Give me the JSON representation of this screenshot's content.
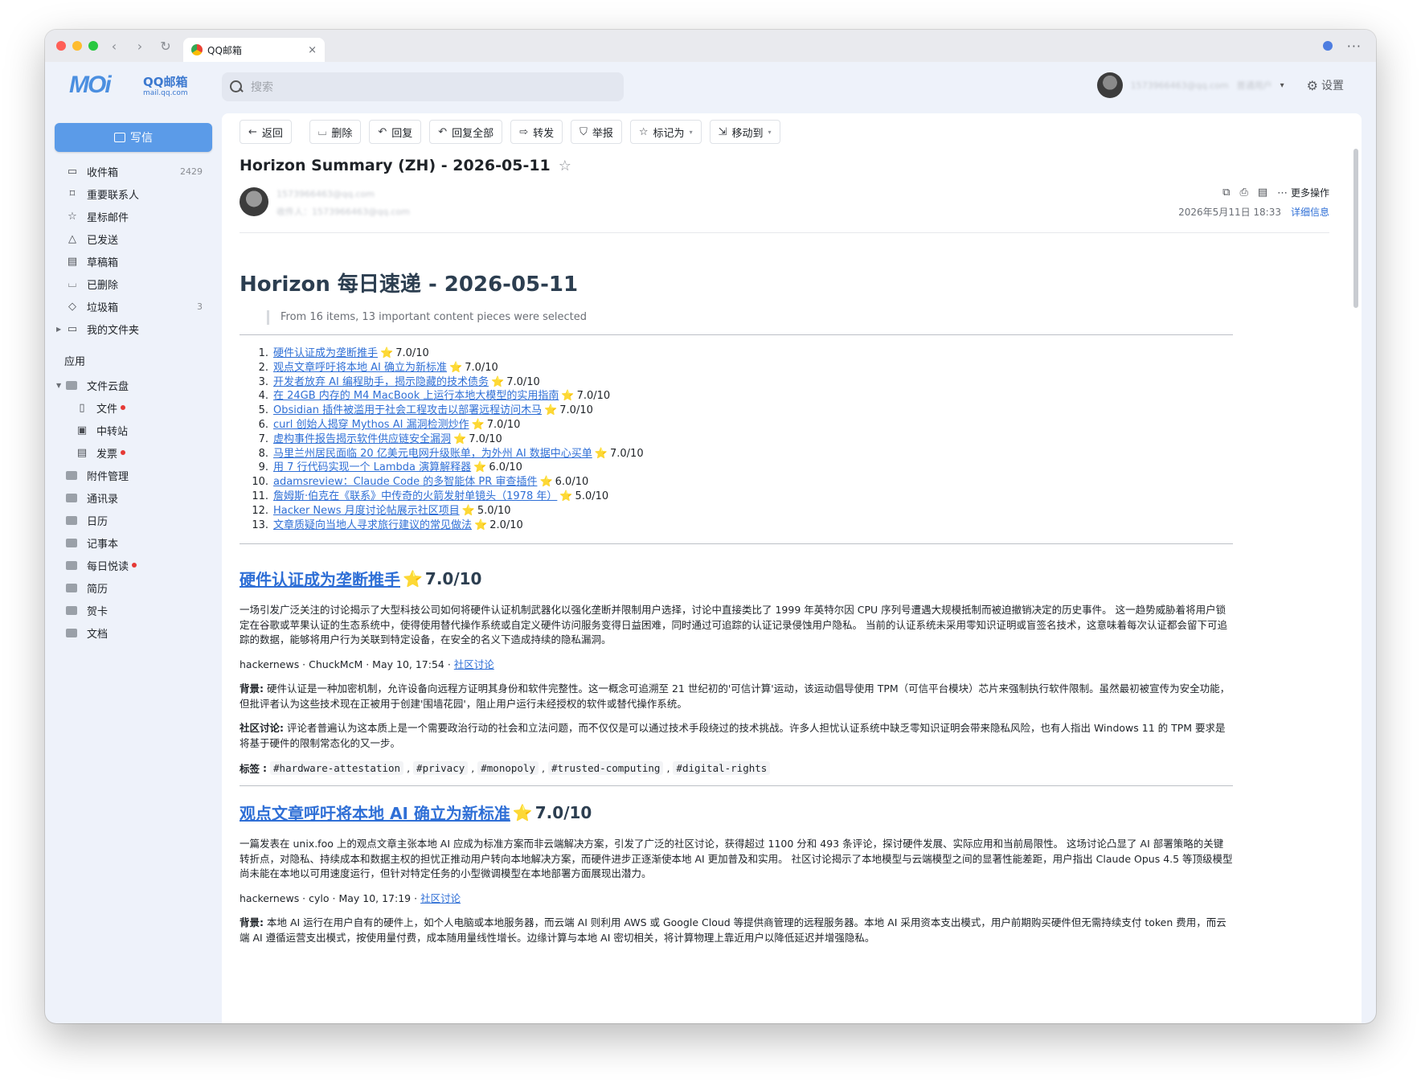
{
  "browser": {
    "tab_title": "QQ邮箱",
    "tab_close": "×",
    "back": "‹",
    "forward": "›",
    "reload": "↻",
    "menu": "···"
  },
  "header": {
    "logo_mark": "MOi",
    "logo_cn": "QQ邮箱",
    "logo_domain": "mail.qq.com",
    "search_placeholder": "搜索",
    "user_email_blurred": "1573966463@qq.com",
    "user_suffix": "普通用户",
    "settings_label": "设置"
  },
  "sidebar": {
    "compose_label": "写信",
    "folders": [
      {
        "icon": "inbox-icon",
        "glyph": "▭",
        "label": "收件箱",
        "count": "2429"
      },
      {
        "icon": "bookmark-icon",
        "glyph": "⌑",
        "label": "重要联系人",
        "count": ""
      },
      {
        "icon": "star-icon",
        "glyph": "☆",
        "label": "星标邮件",
        "count": ""
      },
      {
        "icon": "sent-icon",
        "glyph": "△",
        "label": "已发送",
        "count": ""
      },
      {
        "icon": "draft-icon",
        "glyph": "▤",
        "label": "草稿箱",
        "count": ""
      },
      {
        "icon": "trash-icon",
        "glyph": "🗑",
        "label": "已删除",
        "count": ""
      },
      {
        "icon": "spam-icon",
        "glyph": "⛉",
        "label": "垃圾箱",
        "count": "3"
      },
      {
        "icon": "folder-icon",
        "glyph": "▭",
        "label": "我的文件夹",
        "count": ""
      }
    ],
    "apps_label": "应用",
    "cloud_label": "文件云盘",
    "cloud_items": [
      {
        "label": "文件",
        "dot": true
      },
      {
        "label": "中转站",
        "dot": false
      },
      {
        "label": "发票",
        "dot": true
      }
    ],
    "apps": [
      {
        "label": "附件管理",
        "dot": false
      },
      {
        "label": "通讯录",
        "dot": false
      },
      {
        "label": "日历",
        "dot": false
      },
      {
        "label": "记事本",
        "dot": false
      },
      {
        "label": "每日悦读",
        "dot": true
      },
      {
        "label": "简历",
        "dot": false
      },
      {
        "label": "贺卡",
        "dot": false
      },
      {
        "label": "文档",
        "dot": false
      }
    ]
  },
  "toolbar": {
    "back": "返回",
    "delete": "删除",
    "reply": "回复",
    "reply_all": "回复全部",
    "forward": "转发",
    "report": "举报",
    "mark_as": "标记为",
    "move_to": "移动到"
  },
  "mail": {
    "subject": "Horizon Summary (ZH) - 2026-05-11",
    "sender_blurred": "1573966463@qq.com",
    "recipient_blurred": "收件人：1573966463@qq.com",
    "more_actions": "更多操作",
    "date": "2026年5月11日 18:33",
    "detail_link": "详细信息"
  },
  "content": {
    "h1": "Horizon 每日速递 - 2026-05-11",
    "quote": "From 16 items, 13 important content pieces were selected",
    "toc": [
      {
        "num": "1.",
        "title": "硬件认证成为垄断推手",
        "score": "7.0/10"
      },
      {
        "num": "2.",
        "title": "观点文章呼吁将本地 AI 确立为新标准",
        "score": "7.0/10"
      },
      {
        "num": "3.",
        "title": "开发者放弃 AI 编程助手，揭示隐藏的技术债务",
        "score": "7.0/10"
      },
      {
        "num": "4.",
        "title": "在 24GB 内存的 M4 MacBook 上运行本地大模型的实用指南",
        "score": "7.0/10"
      },
      {
        "num": "5.",
        "title": "Obsidian 插件被滥用于社会工程攻击以部署远程访问木马",
        "score": "7.0/10"
      },
      {
        "num": "6.",
        "title": "curl 创始人揭穿 Mythos AI 漏洞检测炒作",
        "score": "7.0/10"
      },
      {
        "num": "7.",
        "title": "虚构事件报告揭示软件供应链安全漏洞",
        "score": "7.0/10"
      },
      {
        "num": "8.",
        "title": "马里兰州居民面临 20 亿美元电网升级账单，为外州 AI 数据中心买单",
        "score": "7.0/10"
      },
      {
        "num": "9.",
        "title": "用 7 行代码实现一个 Lambda 演算解释器",
        "score": "6.0/10"
      },
      {
        "num": "10.",
        "title": "adamsreview：Claude Code 的多智能体 PR 审查插件",
        "score": "6.0/10"
      },
      {
        "num": "11.",
        "title": "詹姆斯·伯克在《联系》中传奇的火箭发射单镜头（1978 年）",
        "score": "5.0/10"
      },
      {
        "num": "12.",
        "title": "Hacker News 月度讨论帖展示社区项目",
        "score": "5.0/10"
      },
      {
        "num": "13.",
        "title": "文章质疑向当地人寻求旅行建议的常见做法",
        "score": "2.0/10"
      }
    ],
    "sections": [
      {
        "title": "硬件认证成为垄断推手",
        "score": "7.0/10",
        "summary": "一场引发广泛关注的讨论揭示了大型科技公司如何将硬件认证机制武器化以强化垄断并限制用户选择，讨论中直接类比了 1999 年英特尔因 CPU 序列号遭遇大规模抵制而被迫撤销决定的历史事件。 这一趋势威胁着将用户锁定在谷歌或苹果认证的生态系统中，使得使用替代操作系统或自定义硬件访问服务变得日益困难，同时通过可追踪的认证记录侵蚀用户隐私。 当前的认证系统未采用零知识证明或盲签名技术，这意味着每次认证都会留下可追踪的数据，能够将用户行为关联到特定设备，在安全的名义下造成持续的隐私漏洞。",
        "meta": "hackernews · ChuckMcM · May 10, 17:54 · ",
        "meta_link": "社区讨论",
        "background_label": "背景",
        "background": "硬件认证是一种加密机制，允许设备向远程方证明其身份和软件完整性。这一概念可追溯至 21 世纪初的'可信计算'运动，该运动倡导使用 TPM（可信平台模块）芯片来强制执行软件限制。虽然最初被宣传为安全功能，但批评者认为这些技术现在正被用于创建'围墙花园'，阻止用户运行未经授权的软件或替代操作系统。",
        "discussion_label": "社区讨论",
        "discussion": "评论者普遍认为这本质上是一个需要政治行动的社会和立法问题，而不仅仅是可以通过技术手段绕过的技术挑战。许多人担忧认证系统中缺乏零知识证明会带来隐私风险，也有人指出 Windows 11 的 TPM 要求是将基于硬件的限制常态化的又一步。",
        "tags_label": "标签",
        "tags": [
          "#hardware-attestation",
          "#privacy",
          "#monopoly",
          "#trusted-computing",
          "#digital-rights"
        ]
      },
      {
        "title": "观点文章呼吁将本地 AI 确立为新标准",
        "score": "7.0/10",
        "summary": "一篇发表在 unix.foo 上的观点文章主张本地 AI 应成为标准方案而非云端解决方案，引发了广泛的社区讨论，获得超过 1100 分和 493 条评论，探讨硬件发展、实际应用和当前局限性。 这场讨论凸显了 AI 部署策略的关键转折点，对隐私、持续成本和数据主权的担忧正推动用户转向本地解决方案，而硬件进步正逐渐使本地 AI 更加普及和实用。 社区讨论揭示了本地模型与云端模型之间的显著性能差距，用户指出 Claude Opus 4.5 等顶级模型尚未能在本地以可用速度运行，但针对特定任务的小型微调模型在本地部署方面展现出潜力。",
        "meta": "hackernews · cylo · May 10, 17:19 · ",
        "meta_link": "社区讨论",
        "background_label": "背景",
        "background": "本地 AI 运行在用户自有的硬件上，如个人电脑或本地服务器，而云端 AI 则利用 AWS 或 Google Cloud 等提供商管理的远程服务器。本地 AI 采用资本支出模式，用户前期购买硬件但无需持续支付 token 费用，而云端 AI 遵循运营支出模式，按使用量付费，成本随用量线性增长。边缘计算与本地 AI 密切相关，将计算物理上靠近用户以降低延迟并增强隐私。"
      }
    ]
  },
  "colors": {
    "accent": "#2f6fd6",
    "compose": "#5b9be8",
    "star": "#f4b400",
    "red_dot": "#e53935"
  }
}
